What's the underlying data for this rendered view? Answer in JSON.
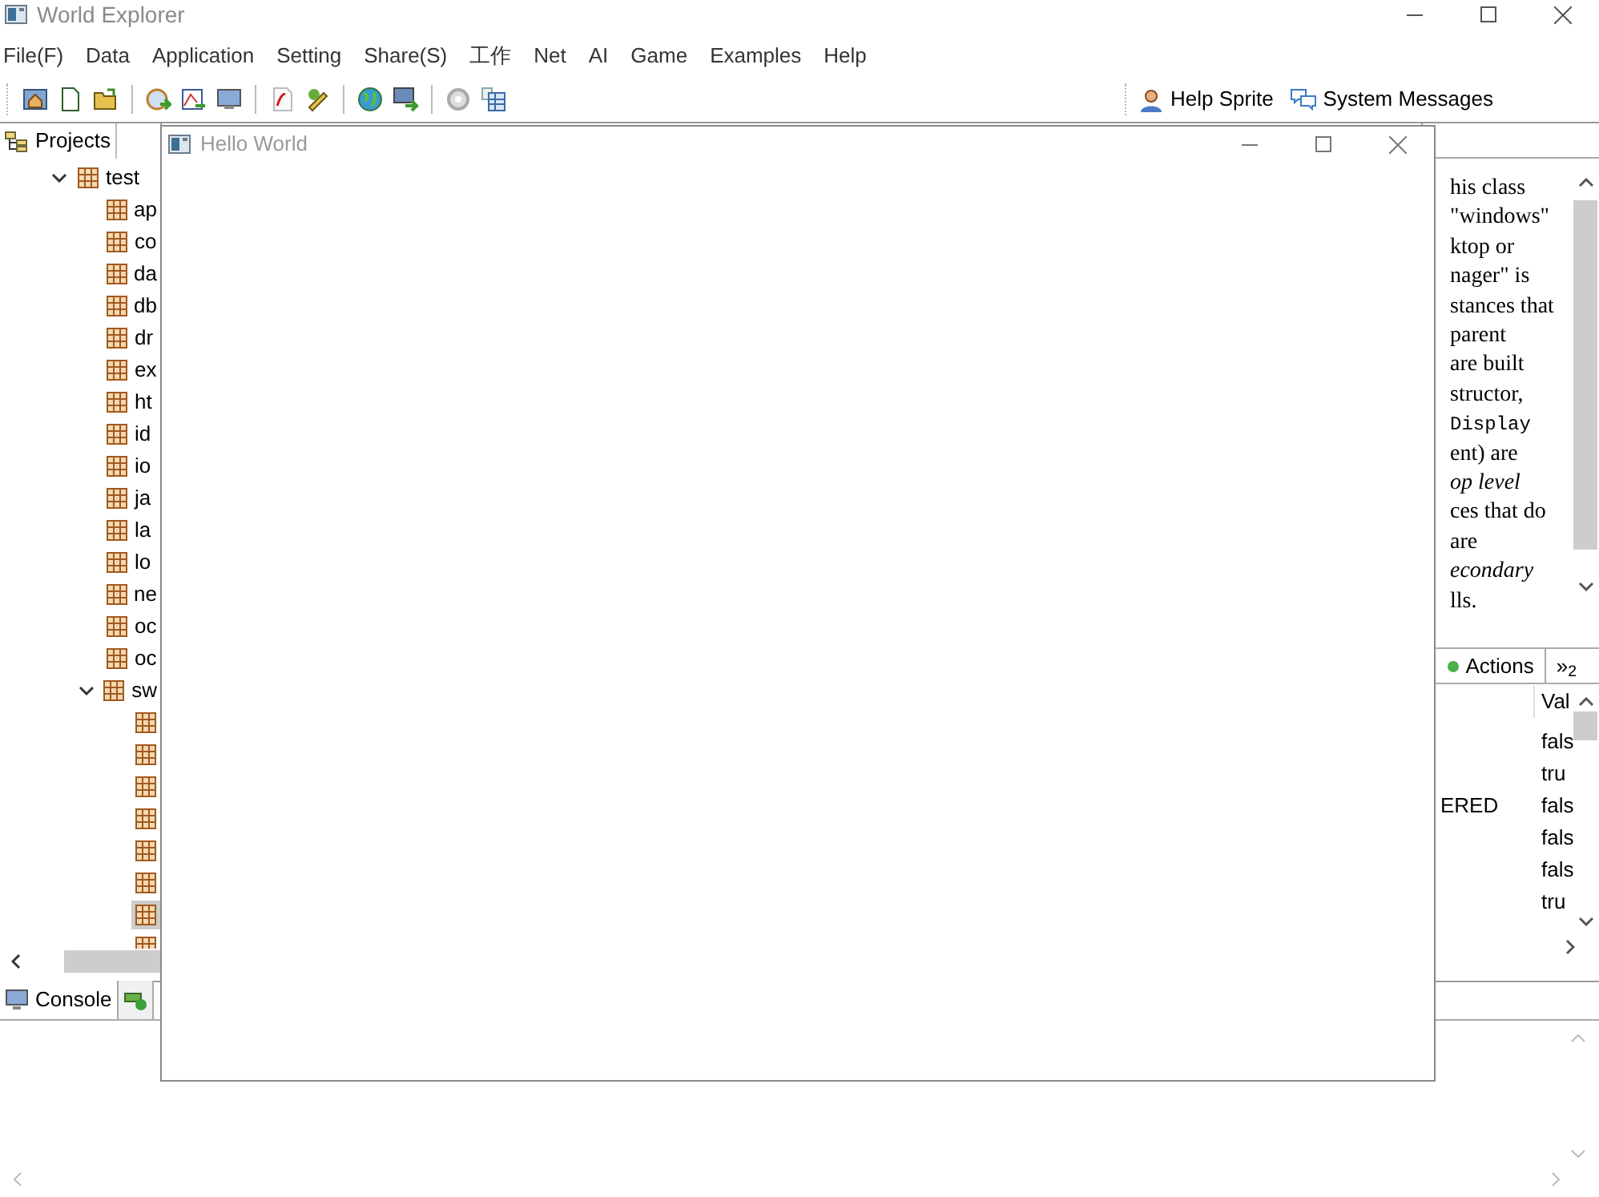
{
  "window": {
    "title": "World Explorer"
  },
  "menu": [
    "File(F)",
    "Data",
    "Application",
    "Setting",
    "Share(S)",
    "工作",
    "Net",
    "AI",
    "Game",
    "Examples",
    "Help"
  ],
  "toolbar_right": [
    {
      "label": "Help Sprite",
      "kind": "person"
    },
    {
      "label": "System Messages",
      "kind": "chat"
    }
  ],
  "projects_panel": {
    "tab": "Projects",
    "tree": [
      {
        "label": "test",
        "expanded": true,
        "children": [
          {
            "label": "ap"
          },
          {
            "label": "co"
          },
          {
            "label": "da"
          },
          {
            "label": "db"
          },
          {
            "label": "dr"
          },
          {
            "label": "ex"
          },
          {
            "label": "ht"
          },
          {
            "label": "id"
          },
          {
            "label": "io"
          },
          {
            "label": "ja"
          },
          {
            "label": "la"
          },
          {
            "label": "lo"
          },
          {
            "label": "ne"
          },
          {
            "label": "oc"
          },
          {
            "label": "oc"
          },
          {
            "label": "sw",
            "expanded": true,
            "children": [
              {
                "selected": false
              },
              {
                "selected": false
              },
              {
                "selected": false
              },
              {
                "selected": false
              },
              {
                "selected": false
              },
              {
                "selected": false
              },
              {
                "selected": true
              },
              {
                "selected": false
              }
            ]
          }
        ]
      }
    ]
  },
  "doc_panel": {
    "lines": [
      {
        "text": "his class",
        "kind": "plain"
      },
      {
        "text": "\"windows\"",
        "kind": "plain"
      },
      {
        "text": "ktop or",
        "kind": "plain"
      },
      {
        "text": "nager\" is",
        "kind": "plain"
      },
      {
        "text": "stances that",
        "kind": "plain"
      },
      {
        "text": "parent",
        "kind": "plain"
      },
      {
        "text": "are built",
        "kind": "plain"
      },
      {
        "text": "structor,",
        "kind": "plain"
      },
      {
        "text": "Display",
        "kind": "code"
      },
      {
        "text": "ent) are",
        "kind": "plain"
      },
      {
        "text": "op level",
        "kind": "italic"
      },
      {
        "text": "ces that do",
        "kind": "plain"
      },
      {
        "text": "are",
        "kind": "plain"
      },
      {
        "text": "econdary",
        "kind": "italic"
      },
      {
        "text": "lls.",
        "kind": "plain"
      }
    ]
  },
  "properties_panel": {
    "tabs": [
      {
        "label": "Actions",
        "kind": "actions"
      },
      {
        "label": "»$_{2}$",
        "kind": "more"
      }
    ],
    "columns": [
      "Val"
    ],
    "rows": [
      {
        "value": "fals"
      },
      {
        "value": "tru"
      },
      {
        "column_1": "ERED",
        "value": "fals"
      },
      {
        "value": "fals"
      },
      {
        "value": "fals"
      },
      {
        "value": "tru"
      }
    ]
  },
  "bottom_panel": {
    "tabs": [
      {
        "label": "Console",
        "selected": true
      },
      {
        "selected": false
      }
    ]
  },
  "dialog": {
    "title": "Hello World",
    "active": false
  }
}
